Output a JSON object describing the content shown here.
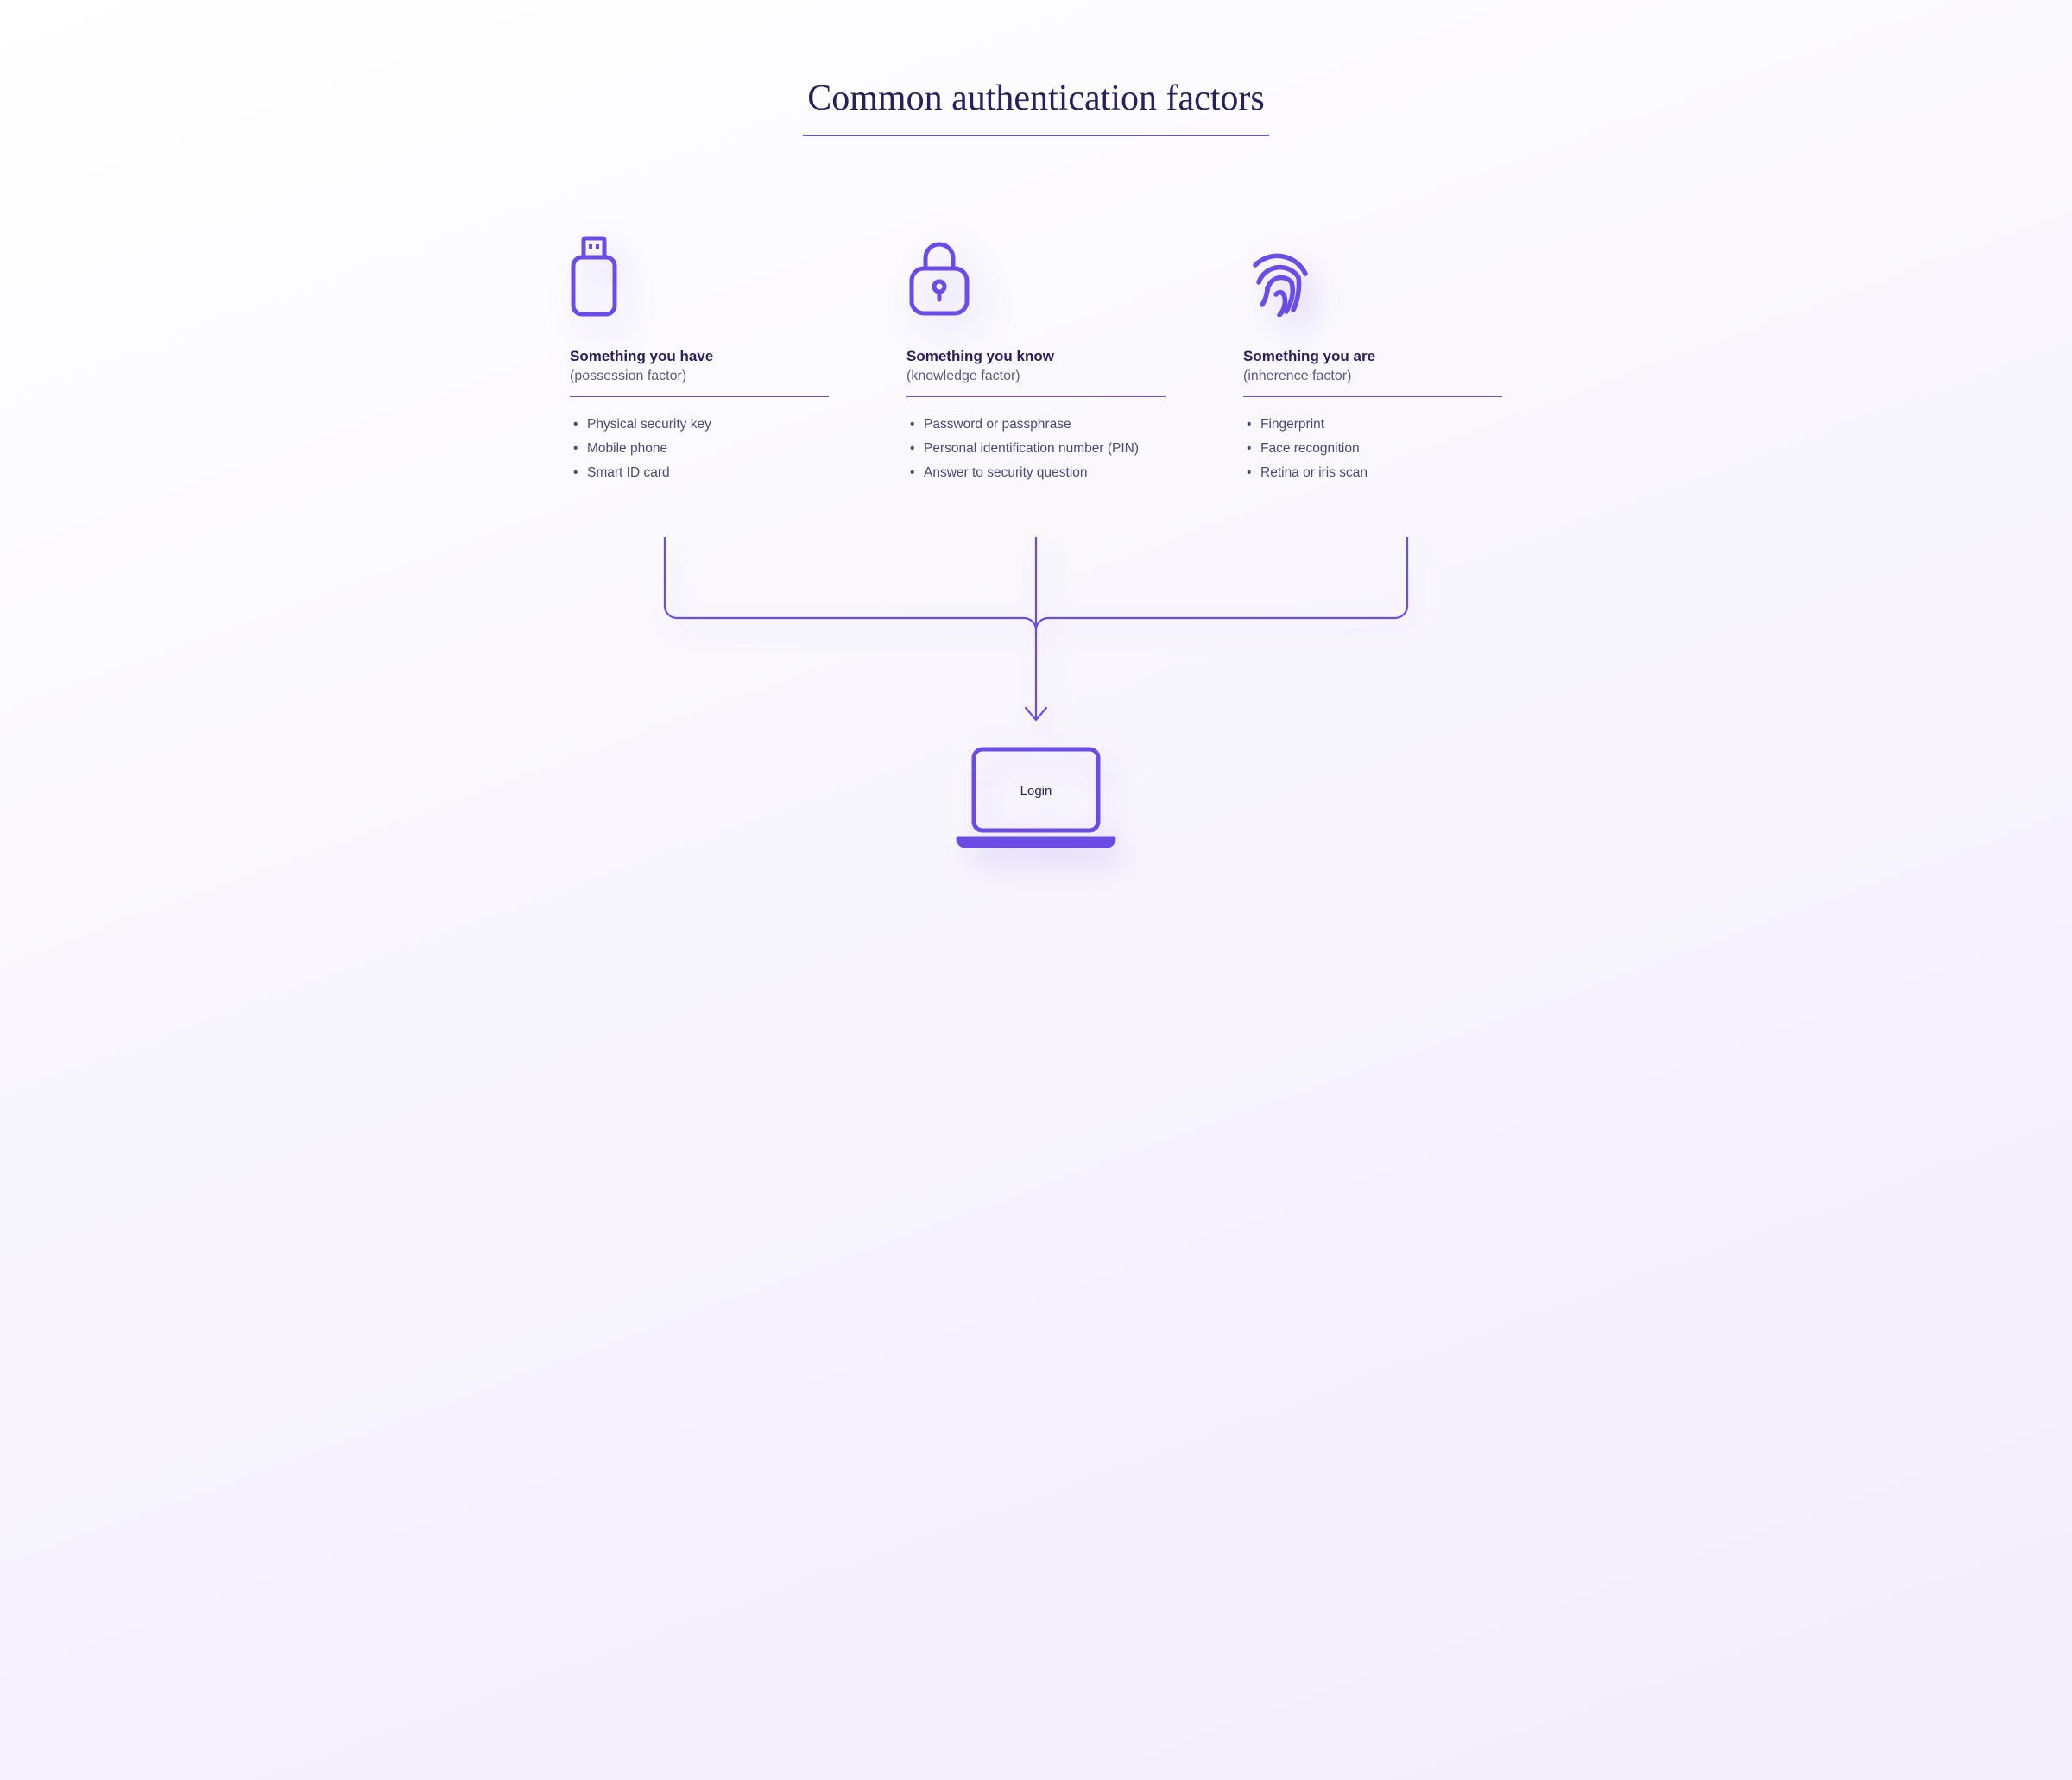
{
  "title": "Common authentication factors",
  "accent_color": "#6b4de6",
  "text_color": "#2a1f5c",
  "factors": [
    {
      "icon": "usb-key-icon",
      "title": "Something you have",
      "subtitle": "(possession factor)",
      "items": [
        "Physical security key",
        "Mobile phone",
        "Smart ID card"
      ]
    },
    {
      "icon": "lock-icon",
      "title": "Something you know",
      "subtitle": "(knowledge factor)",
      "items": [
        "Password or passphrase",
        "Personal identification number (PIN)",
        "Answer to security question"
      ]
    },
    {
      "icon": "fingerprint-icon",
      "title": "Something you are",
      "subtitle": "(inherence factor)",
      "items": [
        "Fingerprint",
        "Face recognition",
        "Retina or iris scan"
      ]
    }
  ],
  "destination_label": "Login"
}
